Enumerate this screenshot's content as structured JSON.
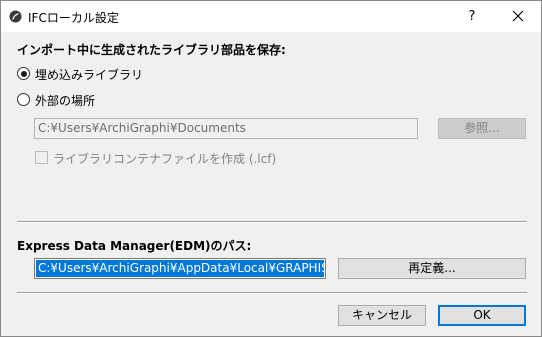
{
  "window": {
    "title": "IFCローカル設定",
    "help_label": "?"
  },
  "import_section": {
    "heading": "インポート中に生成されたライブラリ部品を保存:",
    "options": [
      {
        "label": "埋め込みライブラリ",
        "checked": true
      },
      {
        "label": "外部の場所",
        "checked": false
      }
    ],
    "path_value": "C:¥Users¥ArchiGraphi¥Documents",
    "browse_label": "参照...",
    "container_checkbox_label": "ライブラリコンテナファイルを作成 (.lcf)",
    "container_checked": false
  },
  "edm_section": {
    "heading": "Express Data Manager(EDM)のパス:",
    "path_value": "C:¥Users¥ArchiGraphi¥AppData¥Local¥GRAPHISOFT",
    "redefine_label": "再定義..."
  },
  "footer": {
    "cancel_label": "キャンセル",
    "ok_label": "OK"
  },
  "colors": {
    "accent": "#0078d7",
    "window_bg": "#f0f0f0"
  }
}
